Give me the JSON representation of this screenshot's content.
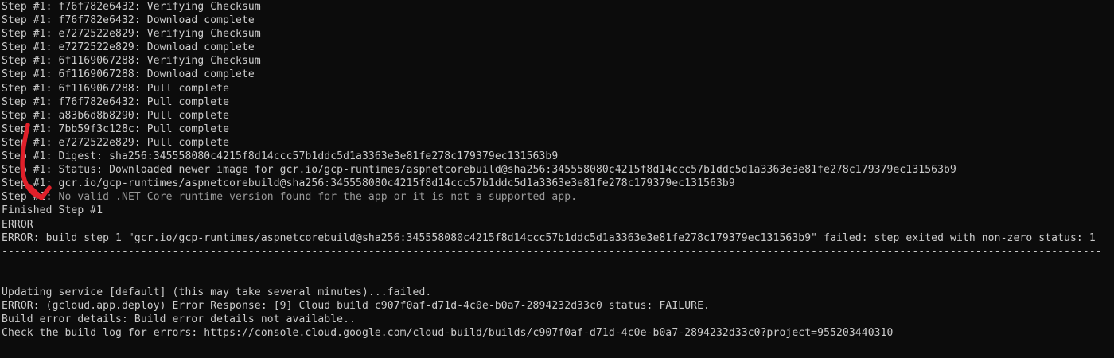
{
  "terminal": {
    "lines": [
      {
        "text": "Step #1: f76f782e6432: Verifying Checksum"
      },
      {
        "text": "Step #1: f76f782e6432: Download complete"
      },
      {
        "text": "Step #1: e7272522e829: Verifying Checksum"
      },
      {
        "text": "Step #1: e7272522e829: Download complete"
      },
      {
        "text": "Step #1: 6f1169067288: Verifying Checksum"
      },
      {
        "text": "Step #1: 6f1169067288: Download complete"
      },
      {
        "text": "Step #1: 6f1169067288: Pull complete"
      },
      {
        "text": "Step #1: f76f782e6432: Pull complete"
      },
      {
        "text": "Step #1: a83b6d8b8290: Pull complete"
      },
      {
        "text": "Step #1: 7bb59f3c128c: Pull complete"
      },
      {
        "text": "Step #1: e7272522e829: Pull complete"
      },
      {
        "text": "Step #1: Digest: sha256:345558080c4215f8d14ccc57b1ddc5d1a3363e3e81fe278c179379ec131563b9"
      },
      {
        "text": "Step #1: Status: Downloaded newer image for gcr.io/gcp-runtimes/aspnetcorebuild@sha256:345558080c4215f8d14ccc57b1ddc5d1a3363e3e81fe278c179379ec131563b9"
      },
      {
        "text": "Step #1: gcr.io/gcp-runtimes/aspnetcorebuild@sha256:345558080c4215f8d14ccc57b1ddc5d1a3363e3e81fe278c179379ec131563b9"
      },
      {
        "prefix": "Step #1: ",
        "text": "No valid .NET Core runtime version found for the app or it is not a supported app."
      },
      {
        "text": "Finished Step #1"
      },
      {
        "text": "ERROR"
      },
      {
        "text": "ERROR: build step 1 \"gcr.io/gcp-runtimes/aspnetcorebuild@sha256:345558080c4215f8d14ccc57b1ddc5d1a3363e3e81fe278c179379ec131563b9\" failed: step exited with non-zero status: 1"
      },
      {
        "text": "------------------------------------------------------------------------------------------------------------------------------------------------------------------------------"
      },
      {
        "text": ""
      },
      {
        "text": ""
      },
      {
        "text": "Updating service [default] (this may take several minutes)...failed."
      },
      {
        "text": "ERROR: (gcloud.app.deploy) Error Response: [9] Cloud build c907f0af-d71d-4c0e-b0a7-2894232d33c0 status: FAILURE."
      },
      {
        "text": "Build error details: Build error details not available.."
      },
      {
        "text": "Check the build log for errors: https://console.cloud.google.com/cloud-build/builds/c907f0af-d71d-4c0e-b0a7-2894232d33c0?project=955203440310"
      }
    ]
  },
  "annotation": {
    "color": "#e0202a",
    "icon": "red-arrow-annotation-icon"
  }
}
